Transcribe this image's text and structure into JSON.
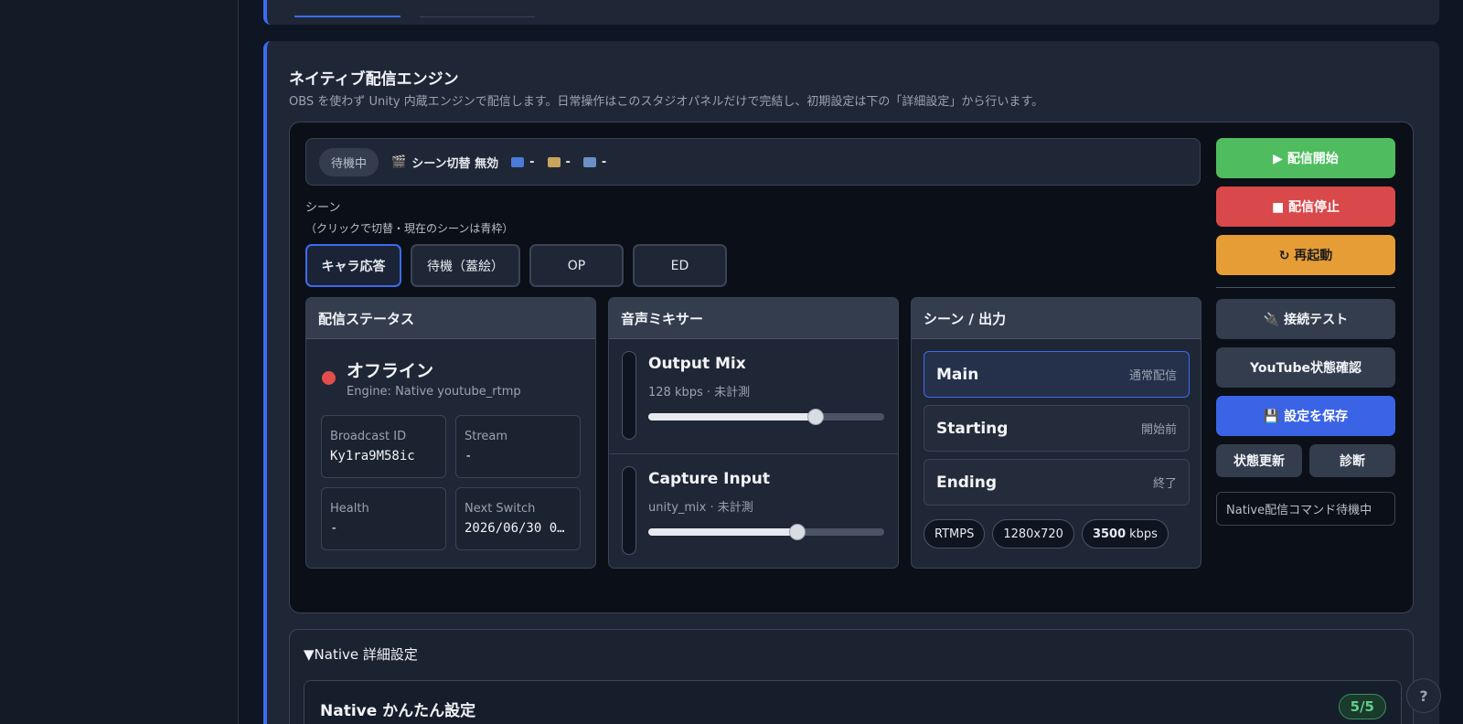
{
  "section": {
    "title": "ネイティブ配信エンジン",
    "description": "OBS を使わず Unity 内蔵エンジンで配信します。日常操作はこのスタジオパネルだけで完結し、初期設定は下の「詳細設定」から行います。"
  },
  "statusbar": {
    "state": "待機中",
    "scene_switch": "シーン切替 無効",
    "stat1": "-",
    "stat2": "-",
    "stat3": "-"
  },
  "scenes": {
    "label": "シーン",
    "hint": "（クリックで切替・現在のシーンは青枠）",
    "buttons": [
      "キャラ応答",
      "待機（蓋絵）",
      "OP",
      "ED"
    ],
    "active_index": 0
  },
  "broadcast_status": {
    "title": "配信ステータス",
    "state": "オフライン",
    "engine": "Engine: Native youtube_rtmp",
    "fields": [
      {
        "label": "Broadcast ID",
        "value": "Ky1ra9M58ic"
      },
      {
        "label": "Stream",
        "value": "-"
      },
      {
        "label": "Health",
        "value": "-"
      },
      {
        "label": "Next Switch",
        "value": "2026/06/30 0…"
      }
    ]
  },
  "mixer": {
    "title": "音声ミキサー",
    "channels": [
      {
        "name": "Output Mix",
        "sub": "128 kbps · 未計測",
        "level": 0.71
      },
      {
        "name": "Capture Input",
        "sub": "unity_mix · 未計測",
        "level": 0.63
      }
    ]
  },
  "output": {
    "title": "シーン / 出力",
    "items": [
      {
        "name": "Main",
        "tag": "通常配信"
      },
      {
        "name": "Starting",
        "tag": "開始前"
      },
      {
        "name": "Ending",
        "tag": "終了"
      }
    ],
    "active_index": 0,
    "chips": {
      "protocol": "RTMPS",
      "resolution": "1280x720",
      "bitrate_value": "3500",
      "bitrate_unit": "kbps"
    }
  },
  "actions": {
    "start": "▶ 配信開始",
    "stop": "■ 配信停止",
    "restart": "↻ 再起動",
    "connection_test": "🔌 接続テスト",
    "youtube_status": "YouTube状態確認",
    "save": "💾 設定を保存",
    "refresh": "状態更新",
    "diagnose": "診断",
    "status_message": "Native配信コマンド待機中"
  },
  "details": {
    "summary": "▼Native 詳細設定",
    "easy_title": "Native かんたん設定",
    "progress": "5/5"
  },
  "help": "?",
  "colors": {
    "accent": "#3b6cf0",
    "start": "#4fbd5f",
    "stop": "#d9484a",
    "restart": "#e69d36",
    "save": "#3b63e6",
    "offline": "#e14d4d"
  }
}
